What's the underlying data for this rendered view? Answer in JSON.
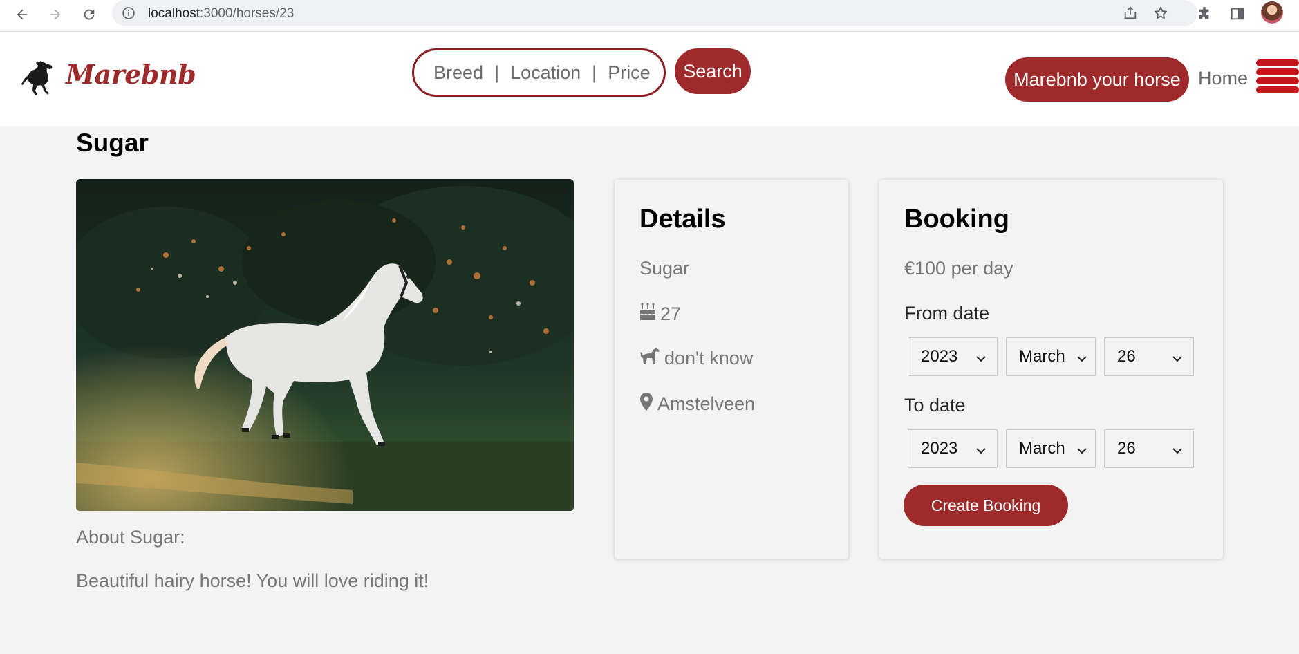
{
  "browser": {
    "url_host": "localhost",
    "url_path": ":3000/horses/23"
  },
  "navbar": {
    "logo_text": "Marebnb",
    "search_breed": "Breed",
    "search_location": "Location",
    "search_price": "Price",
    "search_sep": "|",
    "search_button": "Search",
    "host_button": "Marebnb your horse",
    "home_link": "Home"
  },
  "horse": {
    "title": "Sugar",
    "about_label": "About Sugar:",
    "about_text": "Beautiful hairy horse! You will love riding it!"
  },
  "details": {
    "heading": "Details",
    "name": "Sugar",
    "age": "27",
    "breed": "don't know",
    "location": "Amstelveen"
  },
  "booking": {
    "heading": "Booking",
    "price": "€100 per day",
    "from_label": "From date",
    "to_label": "To date",
    "from_year": "2023",
    "from_month": "March",
    "from_day": "26",
    "to_year": "2023",
    "to_month": "March",
    "to_day": "26",
    "create_button": "Create Booking"
  },
  "colors": {
    "brand": "#9e2a2b",
    "muted_text": "#777777",
    "page_bg": "#f3f3f3"
  }
}
